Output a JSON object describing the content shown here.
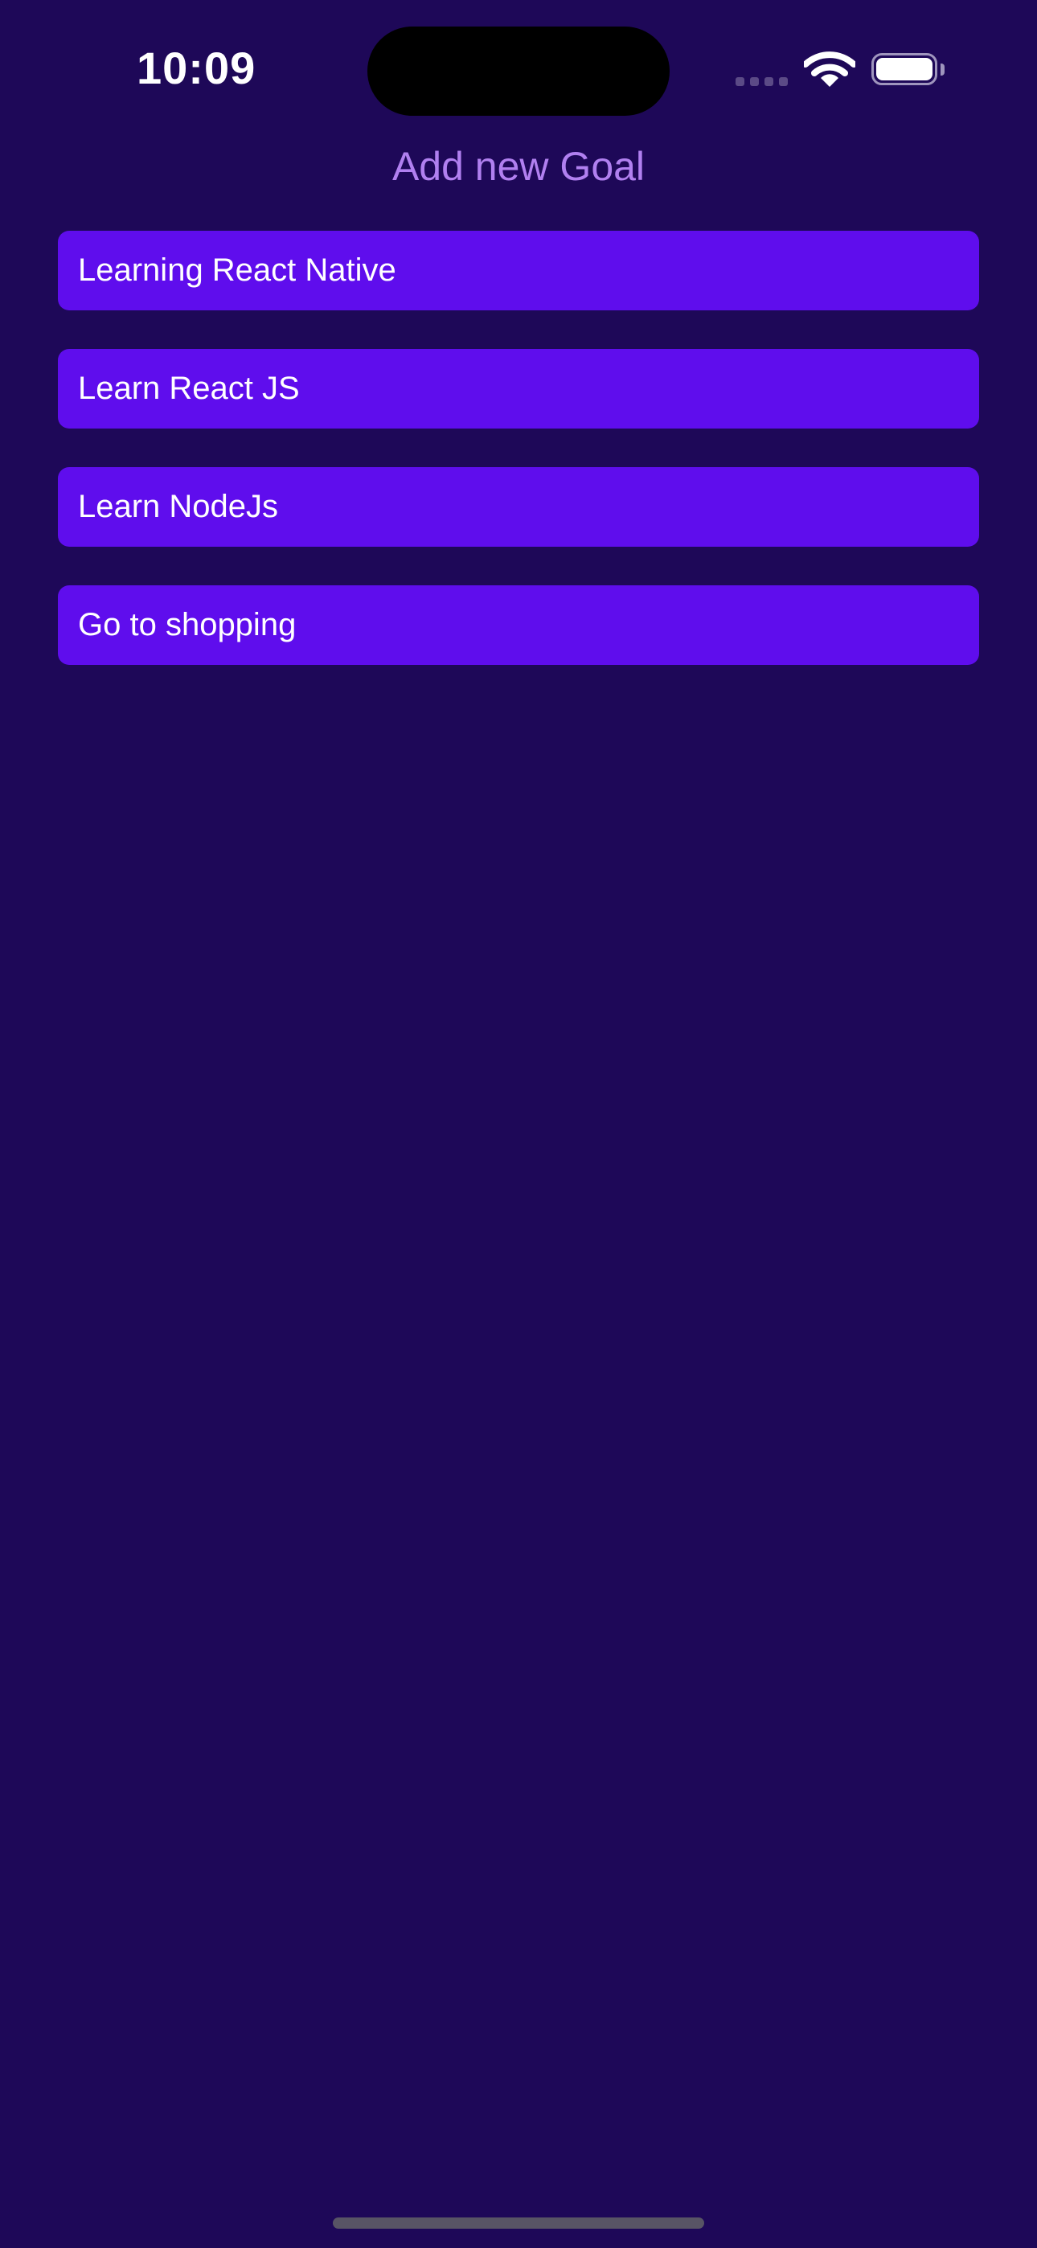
{
  "status_bar": {
    "time": "10:09",
    "icons": [
      "cellular-signal-icon",
      "wifi-icon",
      "battery-icon"
    ]
  },
  "header": {
    "add_goal_label": "Add new Goal"
  },
  "goals": [
    {
      "text": "Learning React Native"
    },
    {
      "text": "Learn React JS"
    },
    {
      "text": "Learn NodeJs"
    },
    {
      "text": "Go to shopping"
    }
  ],
  "colors": {
    "background": "#1e0858",
    "goal_item": "#5f0ded",
    "add_goal_text": "#b180f0",
    "text": "#ffffff"
  }
}
